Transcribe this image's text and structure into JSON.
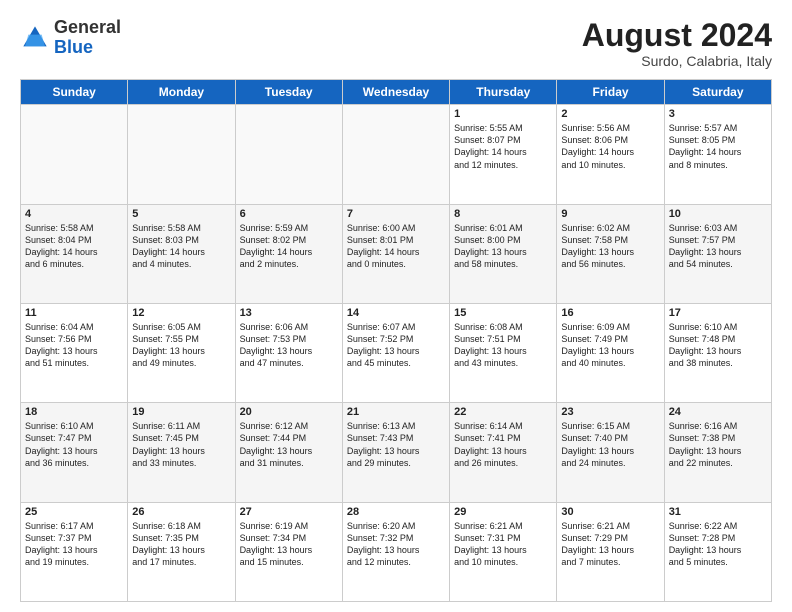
{
  "logo": {
    "general": "General",
    "blue": "Blue"
  },
  "header": {
    "month_year": "August 2024",
    "location": "Surdo, Calabria, Italy"
  },
  "days_of_week": [
    "Sunday",
    "Monday",
    "Tuesday",
    "Wednesday",
    "Thursday",
    "Friday",
    "Saturday"
  ],
  "weeks": [
    [
      {
        "num": "",
        "content": ""
      },
      {
        "num": "",
        "content": ""
      },
      {
        "num": "",
        "content": ""
      },
      {
        "num": "",
        "content": ""
      },
      {
        "num": "1",
        "content": "Sunrise: 5:55 AM\nSunset: 8:07 PM\nDaylight: 14 hours\nand 12 minutes."
      },
      {
        "num": "2",
        "content": "Sunrise: 5:56 AM\nSunset: 8:06 PM\nDaylight: 14 hours\nand 10 minutes."
      },
      {
        "num": "3",
        "content": "Sunrise: 5:57 AM\nSunset: 8:05 PM\nDaylight: 14 hours\nand 8 minutes."
      }
    ],
    [
      {
        "num": "4",
        "content": "Sunrise: 5:58 AM\nSunset: 8:04 PM\nDaylight: 14 hours\nand 6 minutes."
      },
      {
        "num": "5",
        "content": "Sunrise: 5:58 AM\nSunset: 8:03 PM\nDaylight: 14 hours\nand 4 minutes."
      },
      {
        "num": "6",
        "content": "Sunrise: 5:59 AM\nSunset: 8:02 PM\nDaylight: 14 hours\nand 2 minutes."
      },
      {
        "num": "7",
        "content": "Sunrise: 6:00 AM\nSunset: 8:01 PM\nDaylight: 14 hours\nand 0 minutes."
      },
      {
        "num": "8",
        "content": "Sunrise: 6:01 AM\nSunset: 8:00 PM\nDaylight: 13 hours\nand 58 minutes."
      },
      {
        "num": "9",
        "content": "Sunrise: 6:02 AM\nSunset: 7:58 PM\nDaylight: 13 hours\nand 56 minutes."
      },
      {
        "num": "10",
        "content": "Sunrise: 6:03 AM\nSunset: 7:57 PM\nDaylight: 13 hours\nand 54 minutes."
      }
    ],
    [
      {
        "num": "11",
        "content": "Sunrise: 6:04 AM\nSunset: 7:56 PM\nDaylight: 13 hours\nand 51 minutes."
      },
      {
        "num": "12",
        "content": "Sunrise: 6:05 AM\nSunset: 7:55 PM\nDaylight: 13 hours\nand 49 minutes."
      },
      {
        "num": "13",
        "content": "Sunrise: 6:06 AM\nSunset: 7:53 PM\nDaylight: 13 hours\nand 47 minutes."
      },
      {
        "num": "14",
        "content": "Sunrise: 6:07 AM\nSunset: 7:52 PM\nDaylight: 13 hours\nand 45 minutes."
      },
      {
        "num": "15",
        "content": "Sunrise: 6:08 AM\nSunset: 7:51 PM\nDaylight: 13 hours\nand 43 minutes."
      },
      {
        "num": "16",
        "content": "Sunrise: 6:09 AM\nSunset: 7:49 PM\nDaylight: 13 hours\nand 40 minutes."
      },
      {
        "num": "17",
        "content": "Sunrise: 6:10 AM\nSunset: 7:48 PM\nDaylight: 13 hours\nand 38 minutes."
      }
    ],
    [
      {
        "num": "18",
        "content": "Sunrise: 6:10 AM\nSunset: 7:47 PM\nDaylight: 13 hours\nand 36 minutes."
      },
      {
        "num": "19",
        "content": "Sunrise: 6:11 AM\nSunset: 7:45 PM\nDaylight: 13 hours\nand 33 minutes."
      },
      {
        "num": "20",
        "content": "Sunrise: 6:12 AM\nSunset: 7:44 PM\nDaylight: 13 hours\nand 31 minutes."
      },
      {
        "num": "21",
        "content": "Sunrise: 6:13 AM\nSunset: 7:43 PM\nDaylight: 13 hours\nand 29 minutes."
      },
      {
        "num": "22",
        "content": "Sunrise: 6:14 AM\nSunset: 7:41 PM\nDaylight: 13 hours\nand 26 minutes."
      },
      {
        "num": "23",
        "content": "Sunrise: 6:15 AM\nSunset: 7:40 PM\nDaylight: 13 hours\nand 24 minutes."
      },
      {
        "num": "24",
        "content": "Sunrise: 6:16 AM\nSunset: 7:38 PM\nDaylight: 13 hours\nand 22 minutes."
      }
    ],
    [
      {
        "num": "25",
        "content": "Sunrise: 6:17 AM\nSunset: 7:37 PM\nDaylight: 13 hours\nand 19 minutes."
      },
      {
        "num": "26",
        "content": "Sunrise: 6:18 AM\nSunset: 7:35 PM\nDaylight: 13 hours\nand 17 minutes."
      },
      {
        "num": "27",
        "content": "Sunrise: 6:19 AM\nSunset: 7:34 PM\nDaylight: 13 hours\nand 15 minutes."
      },
      {
        "num": "28",
        "content": "Sunrise: 6:20 AM\nSunset: 7:32 PM\nDaylight: 13 hours\nand 12 minutes."
      },
      {
        "num": "29",
        "content": "Sunrise: 6:21 AM\nSunset: 7:31 PM\nDaylight: 13 hours\nand 10 minutes."
      },
      {
        "num": "30",
        "content": "Sunrise: 6:21 AM\nSunset: 7:29 PM\nDaylight: 13 hours\nand 7 minutes."
      },
      {
        "num": "31",
        "content": "Sunrise: 6:22 AM\nSunset: 7:28 PM\nDaylight: 13 hours\nand 5 minutes."
      }
    ]
  ]
}
